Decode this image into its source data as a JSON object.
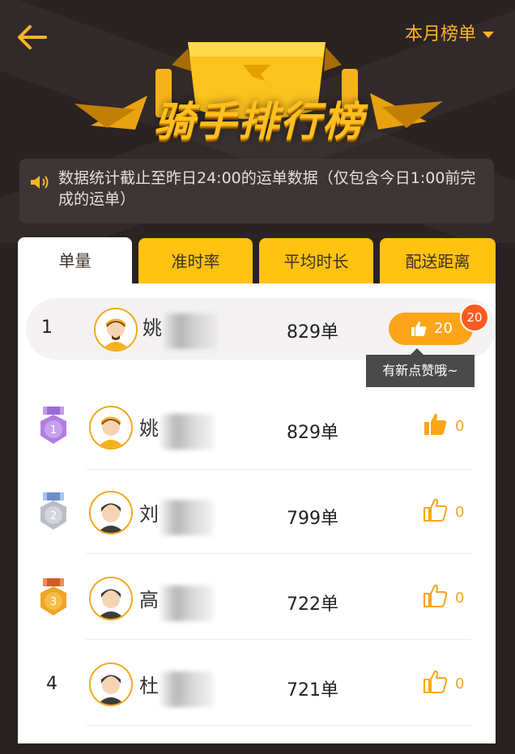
{
  "header": {
    "title": "骑手排行榜",
    "period_label": "本月榜单"
  },
  "notice": {
    "text": "数据统计截止至昨日24:00的运单数据（仅包含今日1:00前完成的运单）"
  },
  "tabs": [
    {
      "label": "单量",
      "active": true
    },
    {
      "label": "准时率",
      "active": false
    },
    {
      "label": "平均时长",
      "active": false
    },
    {
      "label": "配送距离",
      "active": false
    }
  ],
  "my_rank": {
    "rank": "1",
    "name": "姚",
    "orders": "829单",
    "likes": "20",
    "new_likes_badge": "20",
    "tooltip": "有新点赞哦~"
  },
  "ranking": [
    {
      "rank": "1",
      "medal": "gold-medal-icon",
      "name": "姚",
      "orders": "829单",
      "likes": "0",
      "liked": true
    },
    {
      "rank": "2",
      "medal": "silver-medal-icon",
      "name": "刘",
      "orders": "799单",
      "likes": "0",
      "liked": false
    },
    {
      "rank": "3",
      "medal": "bronze-medal-icon",
      "name": "高",
      "orders": "722单",
      "likes": "0",
      "liked": false
    },
    {
      "rank": "4",
      "medal": "",
      "name": "杜",
      "orders": "721单",
      "likes": "0",
      "liked": false
    }
  ],
  "colors": {
    "accent": "#fcb426",
    "tab_bg": "#ffc20f",
    "like_pill": "#fda519",
    "badge": "#ff5a1f",
    "medal_1": "#b07ee0",
    "medal_2": "#b9bec4",
    "medal_3": "#f2a425"
  }
}
